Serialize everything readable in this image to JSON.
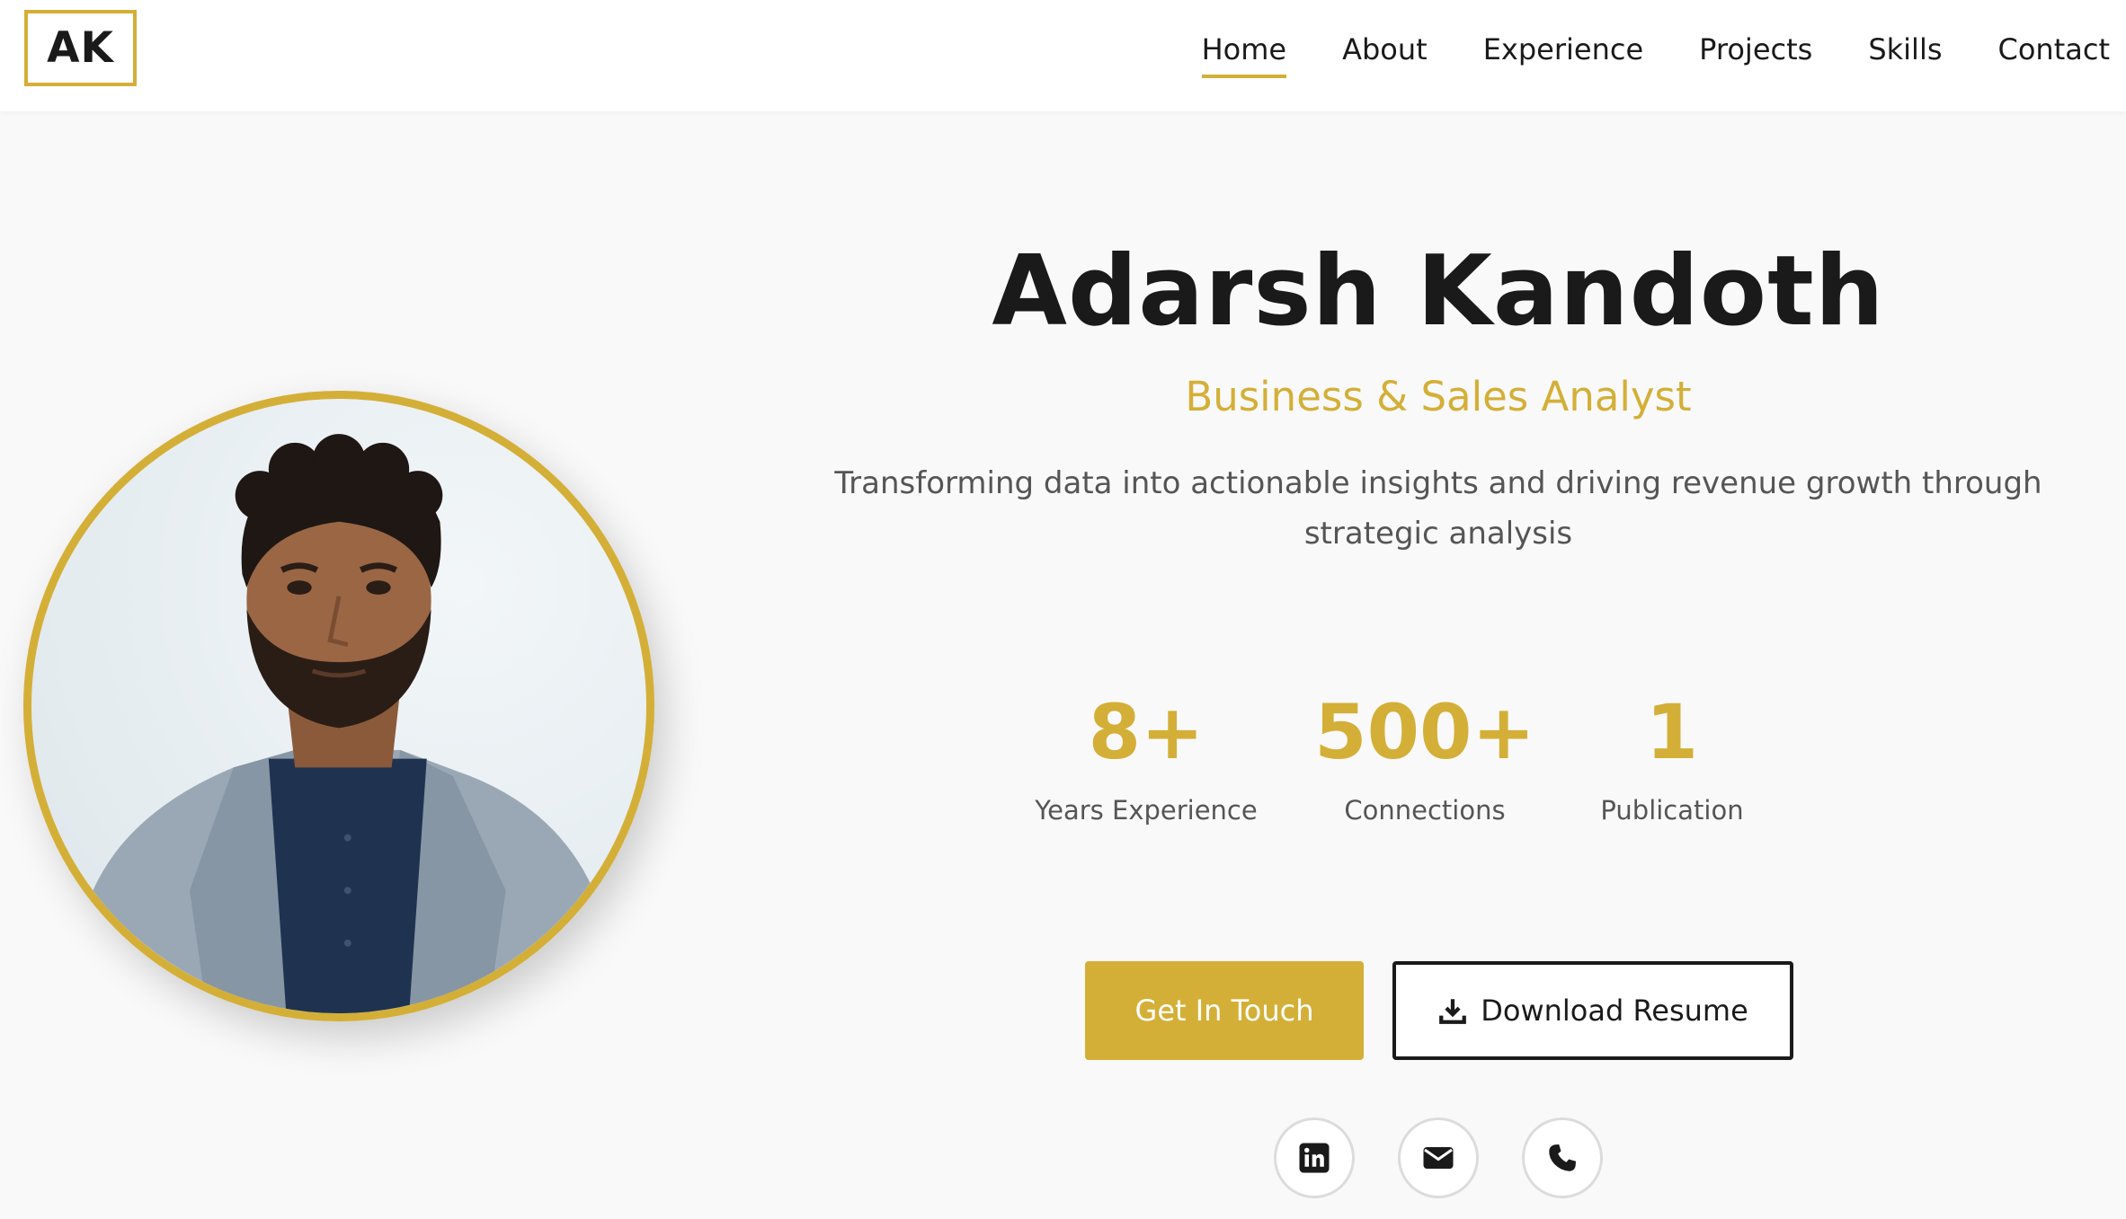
{
  "header": {
    "logo_text": "AK",
    "nav": [
      {
        "label": "Home",
        "active": true
      },
      {
        "label": "About",
        "active": false
      },
      {
        "label": "Experience",
        "active": false
      },
      {
        "label": "Projects",
        "active": false
      },
      {
        "label": "Skills",
        "active": false
      },
      {
        "label": "Contact",
        "active": false
      }
    ]
  },
  "hero": {
    "name": "Adarsh Kandoth",
    "role": "Business & Sales Analyst",
    "tagline": "Transforming data into actionable insights and driving revenue growth through strategic analysis",
    "stats": [
      {
        "value": "8+",
        "label": "Years Experience"
      },
      {
        "value": "500+",
        "label": "Connections"
      },
      {
        "value": "1",
        "label": "Publication"
      }
    ],
    "buttons": {
      "primary_label": "Get In Touch",
      "secondary_label": "Download Resume",
      "secondary_icon": "download-icon"
    },
    "social_icons": [
      "linkedin-icon",
      "email-icon",
      "phone-icon"
    ]
  },
  "colors": {
    "accent": "#d4af37",
    "text_dark": "#1a1a1a",
    "text_muted": "#555555",
    "background": "#f9f9f9"
  }
}
